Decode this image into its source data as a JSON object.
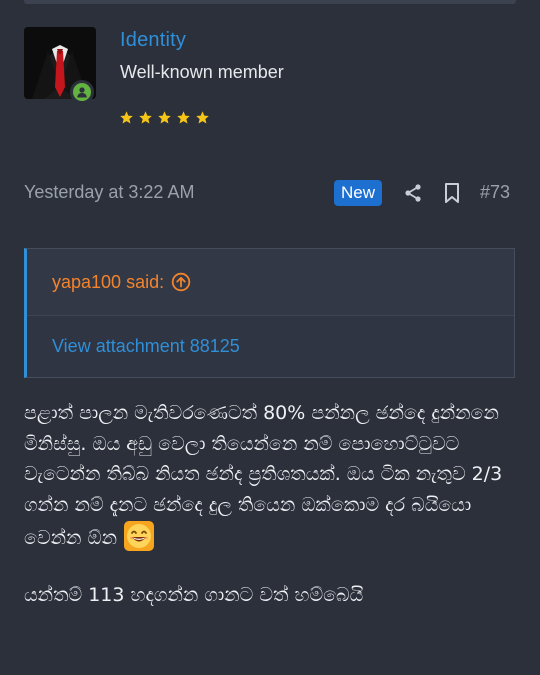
{
  "user": {
    "name": "Identity",
    "title": "Well-known member",
    "rating_stars": 5,
    "status": "online"
  },
  "post": {
    "date": "Yesterday at 3:22 AM",
    "badge": "New",
    "number": "#73",
    "actions": [
      "share-icon",
      "bookmark-icon"
    ]
  },
  "quote": {
    "author_said": "yapa100 said:",
    "attachment": "View attachment 88125"
  },
  "message": {
    "paragraph1": "පළාත් පාලන මැතිවරණෙටත් 80% පන්නල ඡන්දෙ දුන්නනෙ මිනිස්සු. ඔය අඩු වෙලා තියෙන්නෙ නම් පොහොට්ටුවට වැටෙන්න තිබ්බ නියත ඡන්ද ප්‍රතිශතයක්. ඔය ටික නැතුව 2/3 ගන්න නම් දැනට ඡන්දෙ දුල තියෙන ඔක්කොම දර බයියො වෙන්න ඕන",
    "paragraph2": "යන්තම් 113 හදගන්න ගානට වත් හම්බෙයි"
  },
  "colors": {
    "background": "#2b303b",
    "link": "#2f8fd8",
    "quote_author": "#f4842b",
    "badge": "#1d6fd0",
    "star": "#f5c518",
    "online": "#63b340"
  }
}
